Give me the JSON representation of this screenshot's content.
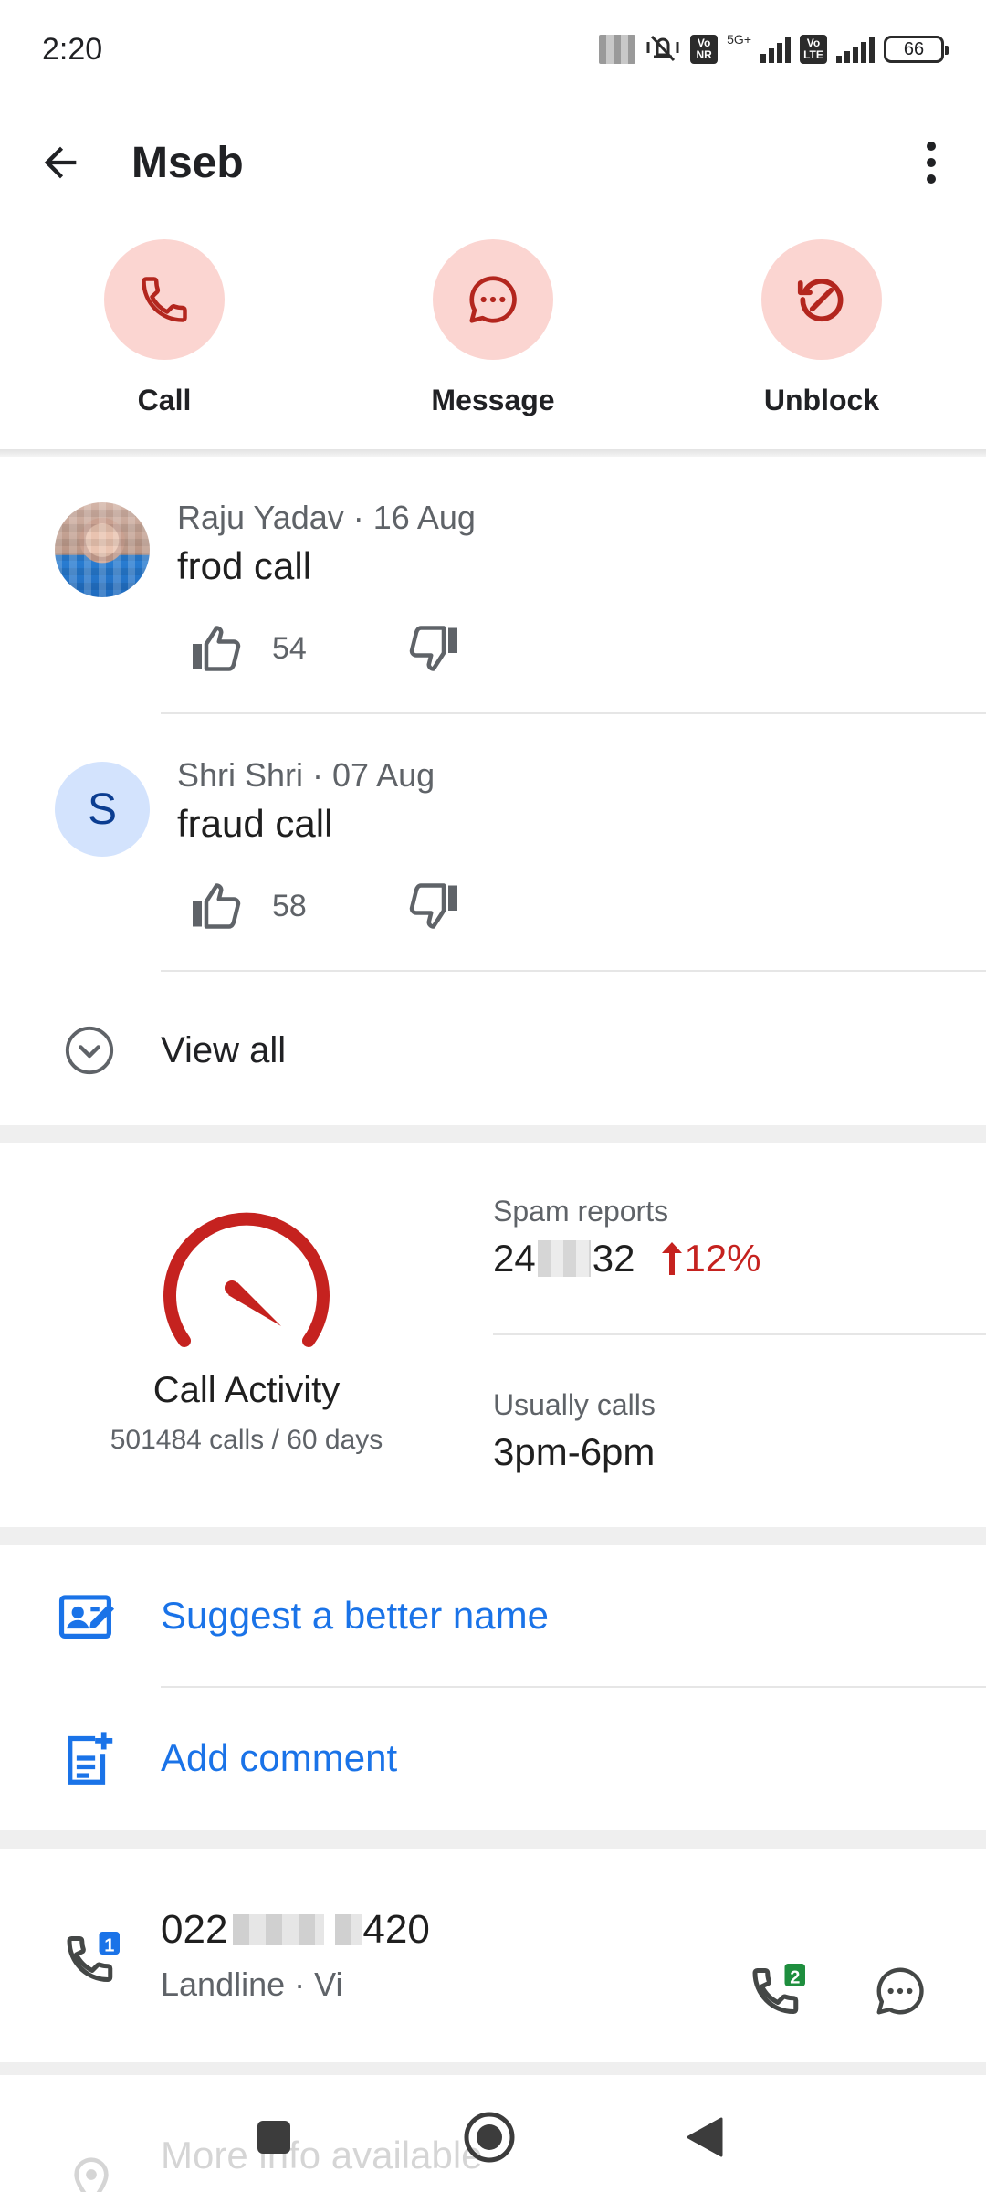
{
  "status_bar": {
    "time": "2:20",
    "network": "5G+",
    "volte_1_top": "Vo",
    "volte_1_bottom": "NR",
    "volte_2_top": "Vo",
    "volte_2_bottom": "LTE",
    "battery": "66"
  },
  "app_bar": {
    "title": "Mseb"
  },
  "actions": [
    {
      "label": "Call",
      "icon": "phone-icon"
    },
    {
      "label": "Message",
      "icon": "chat-bubble-icon"
    },
    {
      "label": "Unblock",
      "icon": "unblock-icon"
    }
  ],
  "comments": [
    {
      "author": "Raju Yadav",
      "date": "16 Aug",
      "meta": "Raju Yadav · 16 Aug",
      "text": "frod call",
      "likes": "54",
      "avatar_type": "photo"
    },
    {
      "author": "Shri Shri",
      "date": "07 Aug",
      "meta": "Shri Shri · 07 Aug",
      "text": "fraud call",
      "likes": "58",
      "avatar_letter": "S"
    }
  ],
  "view_all": {
    "label": "View all"
  },
  "call_activity": {
    "title": "Call Activity",
    "subtitle": "501484 calls / 60 days",
    "accent_color": "#c5221f"
  },
  "stats": {
    "spam_reports_label": "Spam reports",
    "spam_reports_prefix": "24",
    "spam_reports_suffix": "32",
    "spam_trend": "12%",
    "usually_calls_label": "Usually calls",
    "usually_calls_value": "3pm-6pm"
  },
  "links": [
    {
      "label": "Suggest a better name",
      "icon": "edit-contact-icon"
    },
    {
      "label": "Add comment",
      "icon": "add-note-icon"
    }
  ],
  "phone": {
    "number_prefix": "022",
    "number_suffix": "420",
    "type": "Landline · Vi",
    "sim_left": "1",
    "sim_right": "2"
  },
  "more_info": {
    "label": "More info available"
  },
  "colors": {
    "link_blue": "#1a73e8",
    "action_circle": "#fbd5d1",
    "action_icon": "#b3261e"
  }
}
